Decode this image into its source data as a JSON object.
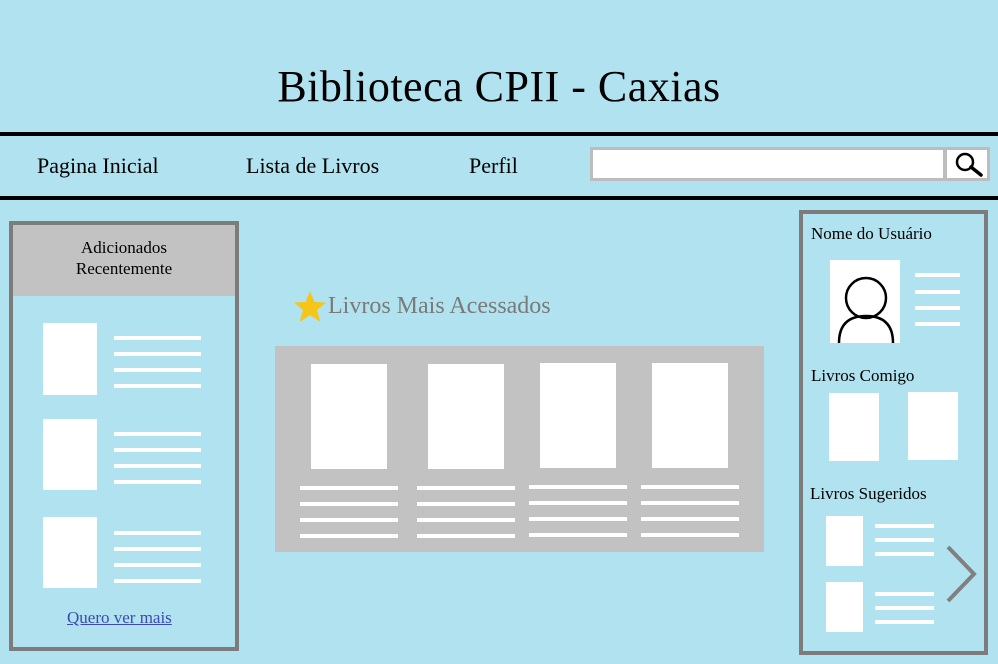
{
  "site": {
    "title": "Biblioteca CPII - Caxias"
  },
  "nav": {
    "items": [
      {
        "label": "Pagina Inicial"
      },
      {
        "label": "Lista de Livros"
      },
      {
        "label": "Perfil"
      }
    ]
  },
  "search": {
    "value": "",
    "placeholder": ""
  },
  "recent": {
    "heading": "Adicionados Recentemente",
    "heading_line1": "Adicionados",
    "heading_line2": "Recentemente",
    "more_link": "Quero ver mais"
  },
  "featured": {
    "title": "Livros Mais Acessados"
  },
  "profile": {
    "username": "Nome do Usuário",
    "my_books_label": "Livros Comigo",
    "suggested_label": "Livros Sugeridos"
  },
  "icons": {
    "search": "search-icon",
    "star": "star-icon",
    "avatar": "user-avatar-icon",
    "next": "chevron-right-icon"
  },
  "colors": {
    "background": "#b0e3ef",
    "panel_border": "#7c7c7c",
    "panel_fill": "#c2c2c2",
    "star": "#f5c518",
    "link": "#3a49b3"
  }
}
